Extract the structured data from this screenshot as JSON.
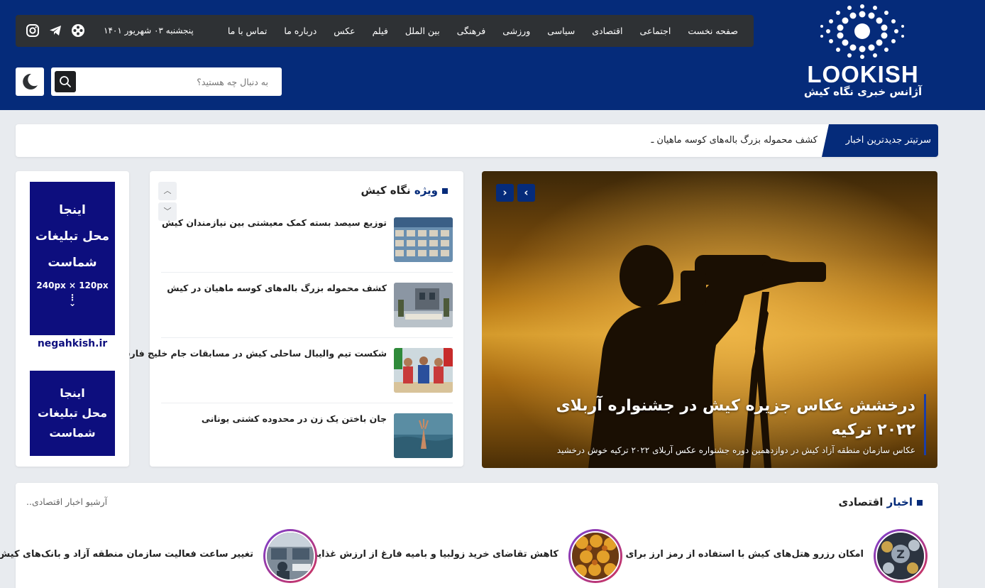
{
  "header": {
    "logo_word": "LOOKISH",
    "logo_sub": "آژانس خبری نگاه کیش",
    "date": "پنجشنبه ۰۳ شهریور ۱۴۰۱",
    "nav": [
      "صفحه نخست",
      "اجتماعی",
      "اقتصادی",
      "سیاسی",
      "ورزشی",
      "فرهنگی",
      "بین الملل",
      "فیلم",
      "عکس",
      "درباره ما",
      "تماس با ما"
    ],
    "social_icons": [
      "instagram-icon",
      "telegram-icon",
      "aparat-icon"
    ],
    "search": {
      "placeholder": "به دنبال چه هستید؟"
    },
    "colors": {
      "brand": "#052b7a",
      "navbar": "#2e3134"
    }
  },
  "ticker": {
    "label": "سرتیتر جدیدترین اخبار",
    "text": "کشف محموله بزرگ باله‌های کوسه ماهیان ـ"
  },
  "slider": {
    "prev": "‹",
    "next": "›",
    "title": "درخشش عکاس جزیره کیش در جشنواره آربلای ۲۰۲۲ ترکیه",
    "subtitle": "عکاس سازمان منطقه آزاد کیش در دوازدهمین دوره جشنواره عکس آربلای ۲۰۲۲ ترکیه خوش درخشید"
  },
  "special": {
    "title_prefix": "ویژه",
    "title_rest": " نگاه کیش",
    "up": "︿",
    "down": "﹀",
    "items": [
      {
        "title": "توزیع سیصد بسته کمک معیشتی بین نیازمندان کیش"
      },
      {
        "title": "کشف محموله بزرگ باله‌های کوسه ماهیان در کیش"
      },
      {
        "title": "شکست تیم والیبال ساحلی کیش در مسابقات جام خلیج فارس"
      },
      {
        "title": "جان باختن یک زن در محدوده کشتی یونانی"
      }
    ]
  },
  "ads": {
    "ad1_lines": [
      "اینجا",
      "محل تبلیغات",
      "شماست"
    ],
    "ad1_size": "240px × 120px",
    "ad1_url": "negahkish.ir",
    "ad2_lines": [
      "اینجا",
      "محل تبلیغات",
      "شماست"
    ]
  },
  "econ": {
    "title_prefix": "اخبار",
    "title_rest": " اقتصادی",
    "archive": "آرشیو اخبار اقتصادی..",
    "items": [
      {
        "title": "امکان رزرو هتل‌های کیش با استفاده از رمز ارز برای"
      },
      {
        "title": "کاهش تقاضای خرید زولبیا و بامیه فارغ از ارزش غذایی"
      },
      {
        "title": "تغییر ساعت فعالیت سازمان منطقه آزاد و بانک‌های کیش"
      }
    ]
  }
}
